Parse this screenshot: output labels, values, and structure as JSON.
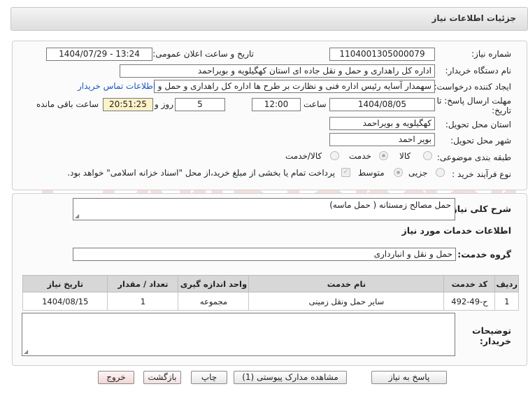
{
  "window": {
    "title": "جزئیات اطلاعات نیاز"
  },
  "form": {
    "need_number_label": "شماره نیاز:",
    "need_number": "1104001305000079",
    "announce_label": "تاریخ و ساعت اعلان عمومی:",
    "announce_value": "1404/07/29 - 13:24",
    "buyer_org_label": "نام دستگاه خریدار:",
    "buyer_org": "اداره کل راهداری و حمل و نقل جاده ای استان کهگیلویه و بویراحمد",
    "requester_label": "ایجاد کننده درخواست:",
    "requester": "سهمدار آسایه رئیس اداره فنی و نظارت بر طرح ها اداره کل راهداری و حمل و نقل",
    "contact_link": "اطلاعات تماس خریدار",
    "deadline_label_1": "مهلت ارسال پاسخ: تا",
    "deadline_label_2": "تاریخ:",
    "deadline_date": "1404/08/05",
    "time_label": "ساعت",
    "deadline_time": "12:00",
    "days_value": "5",
    "days_label": "روز و",
    "remaining_time": "20:51:25",
    "remaining_label": "ساعت باقی مانده",
    "province_label": "استان محل تحویل:",
    "province": "کهگیلویه و بویراحمد",
    "city_label": "شهر محل تحویل:",
    "city": "بویر احمد",
    "category_label": "طبقه بندی موضوعی:",
    "category_options": [
      "کالا",
      "خدمت",
      "کالا/خدمت"
    ],
    "category_selected": "خدمت",
    "process_label": "نوع فرآیند خرید :",
    "process_options": [
      "جزیی",
      "متوسط"
    ],
    "process_selected": "متوسط",
    "payment_text": "پرداخت تمام یا بخشی از مبلغ خرید،از محل \"اسناد خزانه اسلامی\" خواهد بود."
  },
  "details": {
    "desc_label": "شرح کلی نیاز:",
    "desc_value": "حمل مصالح زمستانه ( حمل ماسه)",
    "services_heading": "اطلاعات خدمات مورد نیاز",
    "service_group_label": "گروه خدمت:",
    "service_group": "حمل و نقل و انبارداری",
    "buyer_notes_label_1": "توضیحات",
    "buyer_notes_label_2": "خریدار:",
    "buyer_notes": ""
  },
  "table": {
    "headers": [
      "ردیف",
      "کد خدمت",
      "نام خدمت",
      "واحد اندازه گیری",
      "تعداد / مقدار",
      "تاریخ نیاز"
    ],
    "rows": [
      [
        "1",
        "ح-49-492",
        "سایر حمل ونقل زمینی",
        "مجموعه",
        "1",
        "1404/08/15"
      ]
    ]
  },
  "buttons": {
    "reply": "پاسخ به نیاز",
    "view_docs": "مشاهده مدارک پیوستی (1)",
    "print": "چاپ",
    "back": "بازگشت",
    "exit": "خروج"
  },
  "watermark": {
    "text": "AriaTender.net",
    "color": "#c0392b"
  }
}
